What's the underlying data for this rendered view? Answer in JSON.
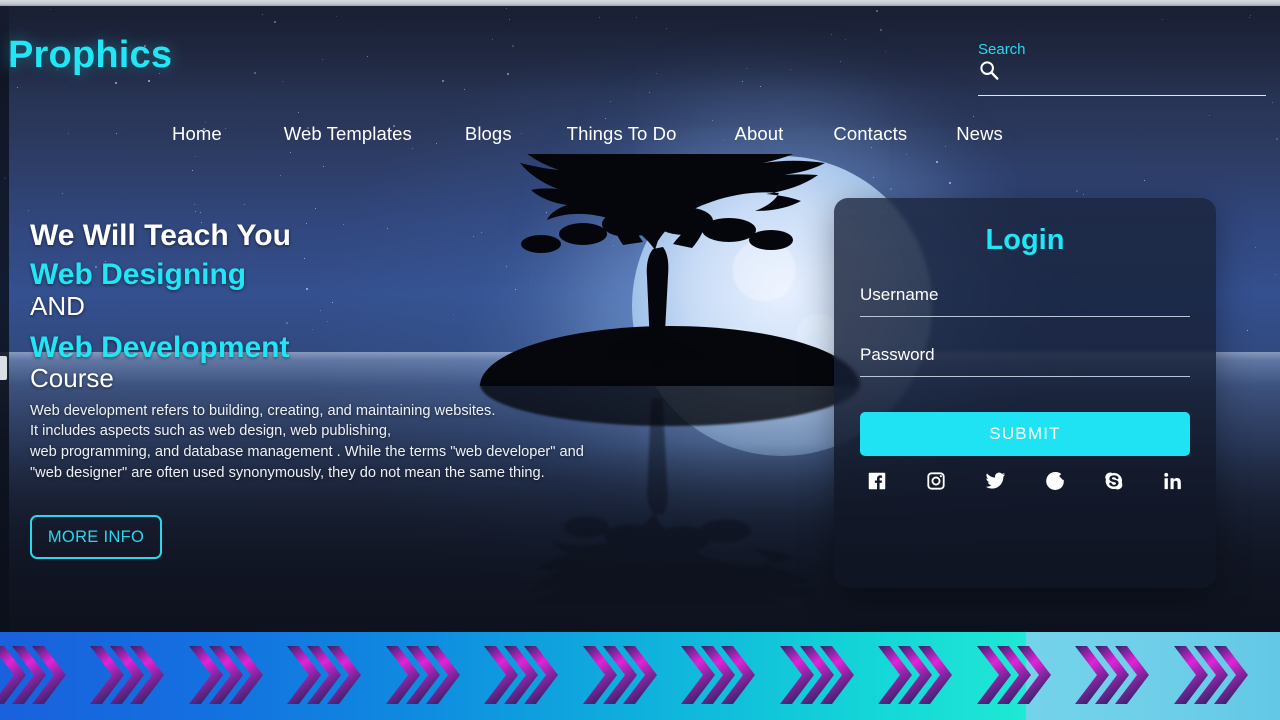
{
  "site": {
    "logo": "Prophics",
    "accent_cyan": "#20e6f5",
    "submit_cyan": "#1fe3f2"
  },
  "header": {
    "search": {
      "label": "Search",
      "icon": "search-icon",
      "value": "",
      "placeholder": ""
    },
    "nav": [
      {
        "label": "Home"
      },
      {
        "label": "Web Templates"
      },
      {
        "label": "Blogs"
      },
      {
        "label": "Things To Do"
      },
      {
        "label": "About"
      },
      {
        "label": "Contacts"
      },
      {
        "label": "News"
      }
    ]
  },
  "hero": {
    "line1": "We Will Teach You",
    "line2": "Web Designing",
    "and": "AND",
    "line3": "Web Development",
    "course": "Course",
    "paragraph": "Web development refers to building, creating, and maintaining websites.\nIt includes aspects such as web design, web publishing,\nweb programming, and database management . While the terms \"web developer\" and\n\"web designer\" are often used synonymously, they do not mean the same thing.",
    "more_info_label": "MORE INFO"
  },
  "login": {
    "title": "Login",
    "username": {
      "label": "Username",
      "value": "",
      "placeholder": ""
    },
    "password": {
      "label": "Password",
      "value": "",
      "placeholder": ""
    },
    "submit_label": "SUBMIT",
    "socials": [
      {
        "name": "facebook-icon",
        "label": "Facebook"
      },
      {
        "name": "instagram-icon",
        "label": "Instagram"
      },
      {
        "name": "twitter-icon",
        "label": "Twitter"
      },
      {
        "name": "google-icon",
        "label": "Google"
      },
      {
        "name": "skype-icon",
        "label": "Skype"
      },
      {
        "name": "linkedin-icon",
        "label": "LinkedIn"
      }
    ]
  },
  "footer_strip": {
    "icon": "double-chevron-right-icon",
    "group_count": 13,
    "arrow_gradient_from": "#2b2466",
    "arrow_gradient_to": "#e024d8",
    "band_from": "#1a61dd",
    "band_to": "#62c8e6"
  }
}
